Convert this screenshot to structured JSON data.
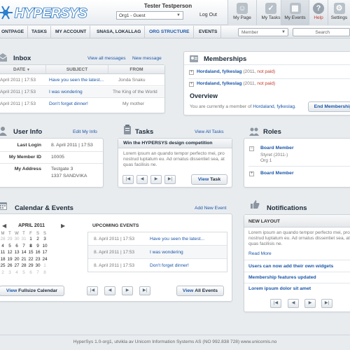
{
  "header": {
    "logo_text": "HYPERSYS",
    "user_name": "Tester Testperson",
    "org_select": "Org1 - Guest",
    "logout": "Log Out",
    "icons": [
      {
        "label": "My Page",
        "icon": "user-icon"
      },
      {
        "label": "My Tasks",
        "icon": "clipboard-icon"
      },
      {
        "label": "My Events",
        "icon": "calendar-icon"
      },
      {
        "label": "Help",
        "icon": "help-icon"
      },
      {
        "label": "Settings",
        "icon": "gear-icon"
      }
    ]
  },
  "nav": {
    "items": [
      "ONTPAGE",
      "TASKS",
      "MY ACCOUNT",
      "SNASA, LOKALLAG",
      "ORG STRUCTURE",
      "EVENTS"
    ],
    "member_select": "Member",
    "search_placeholder": "Search"
  },
  "inbox": {
    "title": "Inbox",
    "view_all": "View all messages",
    "new_message": "New message",
    "columns": [
      "DATE",
      "SUBJECT",
      "FROM"
    ],
    "rows": [
      {
        "date": "April 2011 | 17:53",
        "subject": "Have you seen the latest...",
        "from": "Jonda Snaku"
      },
      {
        "date": "April 2011 | 17:53",
        "subject": "I was wondering",
        "from": "The King of the World"
      },
      {
        "date": "April 2011 | 17:53",
        "subject": "Don't forget dinner!",
        "from": "My mother"
      }
    ]
  },
  "memberships": {
    "title": "Memberships",
    "items": [
      {
        "name": "Hordaland, fylkeslag",
        "year": "(2011,",
        "status": "not paid)"
      },
      {
        "name": "Hordaland, fylkeslag",
        "year": "(2011,",
        "status": "not paid)"
      }
    ],
    "overview_title": "Overview",
    "overview_text": "You are currently a member of",
    "overview_org": "Hordaland, fylkeslag.",
    "end_button": "End Membership"
  },
  "user_info": {
    "title": "User Info",
    "edit": "Edit My Info",
    "last_login_label": "Last Login",
    "last_login": "8. April 2011 | 17:53",
    "member_id_label": "My Member ID",
    "member_id": "10005",
    "address_label": "My Address",
    "address_line1": "Testgate 3",
    "address_line2": "1337 SANDVIKA"
  },
  "tasks": {
    "title": "Tasks",
    "view_all": "View All Tasks",
    "task_title": "Win the HYPERSYS design competition",
    "task_text": "Lorem ipsum an quando tempor perfecto mei, pro nostrud luptatum eu. Ad ornatus dissentiet sea, at quas facilisis ne.",
    "view_task_prefix": "View",
    "view_task_suffix": "Task"
  },
  "roles": {
    "title": "Roles",
    "items": [
      {
        "name": "Board Member",
        "sub1": "Styret (2011-)",
        "sub2": "Org 1"
      },
      {
        "name": "Board Member",
        "sub1": "",
        "sub2": ""
      }
    ]
  },
  "calendar": {
    "title": "Calendar & Events",
    "add_event": "Add New Event",
    "month": "APRIL 2011",
    "weekdays": [
      "M",
      "T",
      "W",
      "T",
      "F",
      "S",
      "S"
    ],
    "upcoming_title": "UPCOMING EVENTS",
    "events": [
      {
        "date": "8. April 2011 | 17:53",
        "title": "Have you seen the latest..."
      },
      {
        "date": "8. April 2011 | 17:53",
        "title": "I was wondering"
      },
      {
        "date": "8. April 2011 | 17:53",
        "title": "Don't forget dinner!"
      }
    ],
    "fullsize_prefix": "View",
    "fullsize_suffix": "Fullsize Calendar",
    "all_events_prefix": "View",
    "all_events_suffix": "All Events"
  },
  "notifications": {
    "title": "Notifications",
    "new_layout_title": "NEW LAYOUT",
    "new_layout_text": "Lorem ipsum an quando tempor perfecto mei, pro nostrud luptatum eu. Ad ornatus dissentiet sea, at quas facilisis ne.",
    "read_more": "Read More",
    "items": [
      "Users can now add their own widgets",
      "Membership features updated",
      "Lorem ipsum dolor sit amet"
    ]
  },
  "footer": {
    "text": "HyperSys 1.0-org1, utvikla av Unicorn Information Systems AS (NO 992.838 728) www.unicornis.no"
  },
  "colors": {
    "accent": "#1a56a8",
    "warning": "#c0392b",
    "background": "#e9ecef"
  }
}
